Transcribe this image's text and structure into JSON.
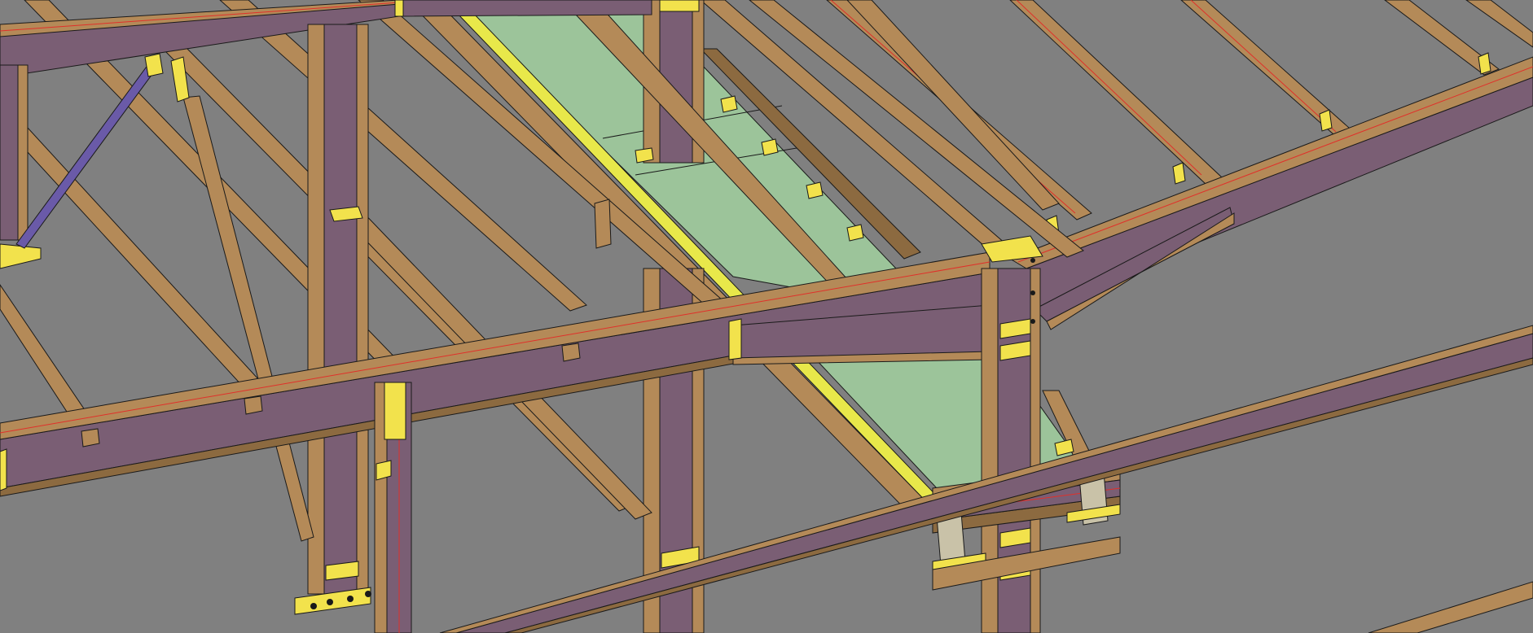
{
  "viewport": {
    "background": "#808080",
    "colors": {
      "beam_web": "#7a5e74",
      "member_tan": "#b48a58",
      "member_dark": "#8c6a40",
      "plate_yellow": "#f2e24c",
      "deck_green": "#9cc49a",
      "deck_edge": "#e8e84a",
      "centerline_red": "#e0302a",
      "outline": "#1a1a1a",
      "brace_blue": "#6a5aa8"
    },
    "model": {
      "kind": "3d-steel-frame",
      "objects": [
        "column",
        "rafter",
        "purlin",
        "brace",
        "base-plate",
        "connection-plate",
        "floor-deck",
        "eave-strut"
      ]
    }
  }
}
